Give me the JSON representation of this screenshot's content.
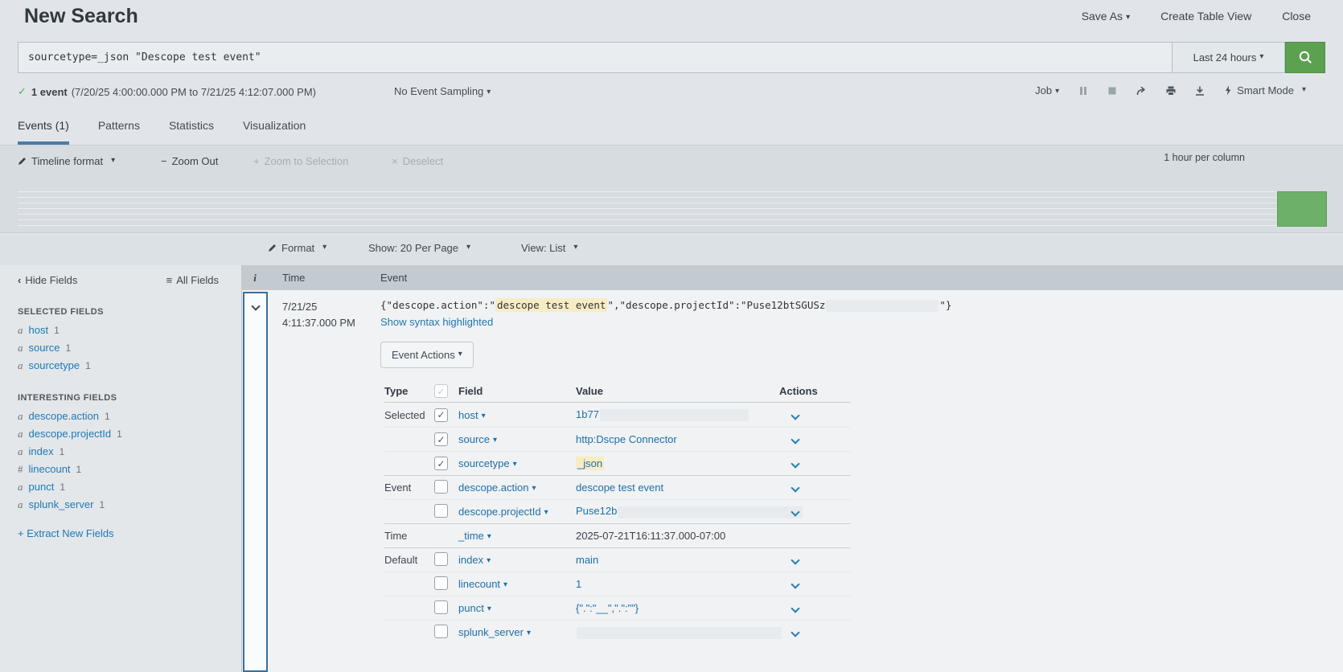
{
  "glyphs": {
    "caret": "▾",
    "check": "✓",
    "minus": "−",
    "plus": "+",
    "x": "×",
    "chevron_left": "‹",
    "list": "≡"
  },
  "header": {
    "title": "New Search",
    "actions": {
      "save_as": "Save As",
      "create_table_view": "Create Table View",
      "close": "Close"
    }
  },
  "search_bar": {
    "query": "sourcetype=_json \"Descope test event\"",
    "time_range": "Last 24 hours"
  },
  "job_bar": {
    "result_count": "1 event",
    "time_window": "(7/20/25 4:00:00.000 PM to 7/21/25 4:12:07.000 PM)",
    "sampling": "No Event Sampling",
    "job": "Job",
    "mode": "Smart Mode"
  },
  "tabs": [
    {
      "label": "Events (1)",
      "active": true
    },
    {
      "label": "Patterns",
      "active": false
    },
    {
      "label": "Statistics",
      "active": false
    },
    {
      "label": "Visualization",
      "active": false
    }
  ],
  "timeline": {
    "format_label": "Timeline format",
    "zoom_out": "Zoom Out",
    "zoom_to_selection": "Zoom to Selection",
    "deselect": "Deselect",
    "scale": "1 hour per column",
    "event_count": 1,
    "bar_color": "#6cb06a"
  },
  "list_controls": {
    "format": "Format",
    "show": "Show: 20 Per Page",
    "view": "View: List"
  },
  "sidebar": {
    "hide_fields": "Hide Fields",
    "all_fields": "All Fields",
    "selected_title": "SELECTED FIELDS",
    "selected": [
      {
        "type": "a",
        "name": "host",
        "count": "1"
      },
      {
        "type": "a",
        "name": "source",
        "count": "1"
      },
      {
        "type": "a",
        "name": "sourcetype",
        "count": "1"
      }
    ],
    "interesting_title": "INTERESTING FIELDS",
    "interesting": [
      {
        "type": "a",
        "name": "descope.action",
        "count": "1"
      },
      {
        "type": "a",
        "name": "descope.projectId",
        "count": "1"
      },
      {
        "type": "a",
        "name": "index",
        "count": "1"
      },
      {
        "type": "#",
        "name": "linecount",
        "count": "1"
      },
      {
        "type": "a",
        "name": "punct",
        "count": "1"
      },
      {
        "type": "a",
        "name": "splunk_server",
        "count": "1"
      }
    ],
    "extract": "+ Extract New Fields"
  },
  "event_list": {
    "columns": {
      "info": "i",
      "time": "Time",
      "event": "Event"
    },
    "event": {
      "date": "7/21/25",
      "time": "4:11:37.000 PM",
      "raw": {
        "prefix": "{\"descope.action\":\"",
        "highlight": "descope test event",
        "middle": "\",\"descope.projectId\":\"Puse12btSGUSz",
        "suffix": "\"}"
      },
      "syntax_link": "Show syntax highlighted",
      "actions_button": "Event Actions"
    }
  },
  "field_table": {
    "headers": {
      "type": "Type",
      "field": "Field",
      "value": "Value",
      "actions": "Actions"
    },
    "rows": [
      {
        "type": "Selected",
        "field": "host",
        "value": "1b77"
      },
      {
        "type": "",
        "field": "source",
        "value": "http:Dscpe Connector"
      },
      {
        "type": "",
        "field": "sourcetype",
        "value": "_json"
      },
      {
        "type": "Event",
        "field": "descope.action",
        "value": "descope test event"
      },
      {
        "type": "",
        "field": "descope.projectId",
        "value": "Puse12b"
      },
      {
        "type": "Time",
        "field": "_time",
        "value": "2025-07-21T16:11:37.000-07:00"
      },
      {
        "type": "Default",
        "field": "index",
        "value": "main"
      },
      {
        "type": "",
        "field": "linecount",
        "value": "1"
      },
      {
        "type": "",
        "field": "punct",
        "value": "{\".\":\"__\",\".\":\"\"}"
      },
      {
        "type": "",
        "field": "splunk_server",
        "value": ""
      }
    ]
  },
  "colors": {
    "accent_green": "#5ca150",
    "timeline_bar_green": "#6cb06a",
    "highlight_yellow": "#f8ecc3",
    "active_tab_blue": "#4a7da5",
    "link_blue": "#1d6fa8"
  }
}
